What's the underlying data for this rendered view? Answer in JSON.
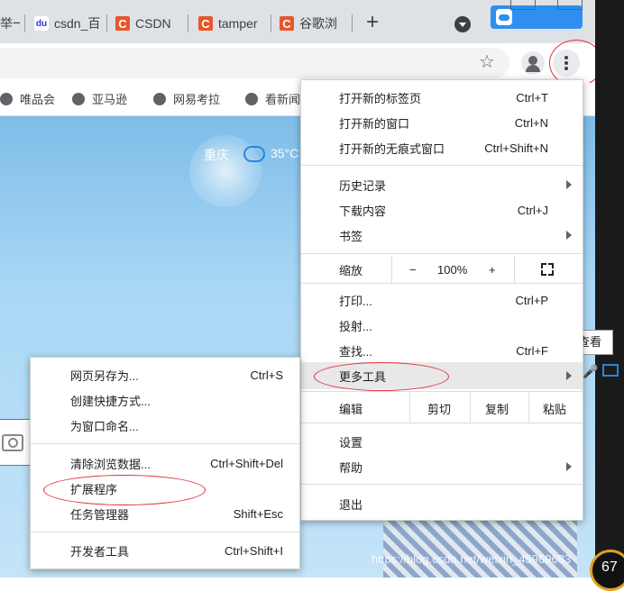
{
  "tabs": [
    {
      "label": "举一",
      "icon": "none"
    },
    {
      "label": "csdn_百",
      "icon": "baidu-icon"
    },
    {
      "label": "CSDN",
      "icon": "csdn-icon"
    },
    {
      "label": "tamper",
      "icon": "csdn-icon"
    },
    {
      "label": "谷歌浏",
      "icon": "csdn-icon"
    }
  ],
  "bookmarks": [
    "唯品会",
    "亚马逊",
    "网易考拉",
    "看新闻"
  ],
  "weather": {
    "city": "重庆",
    "temp": "35°C"
  },
  "chrome_menu": {
    "new_tab": {
      "label": "打开新的标签页",
      "shortcut": "Ctrl+T"
    },
    "new_window": {
      "label": "打开新的窗口",
      "shortcut": "Ctrl+N"
    },
    "new_incognito": {
      "label": "打开新的无痕式窗口",
      "shortcut": "Ctrl+Shift+N"
    },
    "history": {
      "label": "历史记录"
    },
    "downloads": {
      "label": "下载内容",
      "shortcut": "Ctrl+J"
    },
    "bookmarks": {
      "label": "书签"
    },
    "zoom": {
      "label": "缩放",
      "minus": "−",
      "value": "100%",
      "plus": "+"
    },
    "print": {
      "label": "打印...",
      "shortcut": "Ctrl+P"
    },
    "cast": {
      "label": "投射..."
    },
    "find": {
      "label": "查找...",
      "shortcut": "Ctrl+F"
    },
    "more_tools": {
      "label": "更多工具"
    },
    "edit": {
      "label": "编辑",
      "cut": "剪切",
      "copy": "复制",
      "paste": "粘贴"
    },
    "settings": {
      "label": "设置"
    },
    "help": {
      "label": "帮助"
    },
    "exit": {
      "label": "退出"
    }
  },
  "more_tools_menu": {
    "save_page": {
      "label": "网页另存为...",
      "shortcut": "Ctrl+S"
    },
    "create_shortcut": {
      "label": "创建快捷方式..."
    },
    "name_window": {
      "label": "为窗口命名..."
    },
    "clear_data": {
      "label": "清除浏览数据...",
      "shortcut": "Ctrl+Shift+Del"
    },
    "extensions": {
      "label": "扩展程序"
    },
    "task_manager": {
      "label": "任务管理器",
      "shortcut": "Shift+Esc"
    },
    "dev_tools": {
      "label": "开发者工具",
      "shortcut": "Ctrl+Shift+I"
    }
  },
  "side_fragments": {
    "right_label": "查看",
    "badge": "67"
  },
  "watermark": "https://blog.csdn.net/weixin_45969683"
}
